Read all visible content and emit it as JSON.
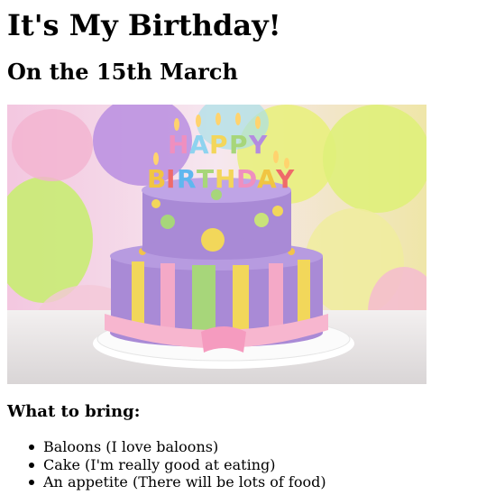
{
  "page": {
    "title": "It's My Birthday!",
    "subtitle": "On the 15th March",
    "image": {
      "alt": "Birthday cake with Happy Birthday candles",
      "icon": "birthday-cake-image",
      "candle_text_line1": "HAPPY",
      "candle_text_line2": "BIRTHDAY"
    },
    "bring_heading": "What to bring:",
    "bring_items": [
      "Baloons (I love baloons)",
      "Cake (I'm really good at eating)",
      "An appetite (There will be lots of food)"
    ]
  }
}
